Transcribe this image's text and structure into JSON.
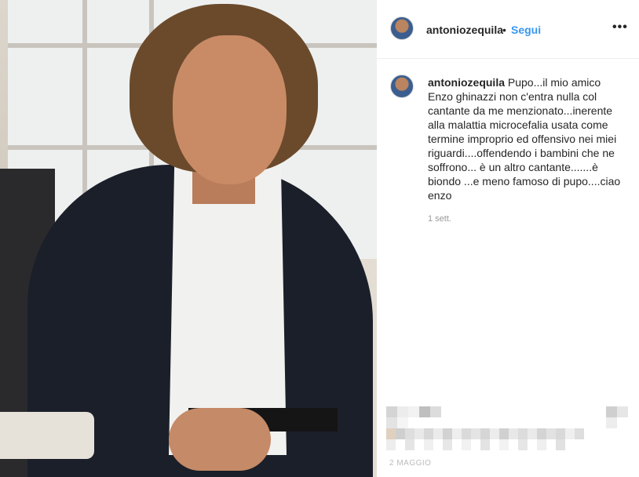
{
  "post": {
    "username": "antoniozequila",
    "separator": "•",
    "follow_label": "Segui",
    "more_icon": "•••",
    "caption_user": "antoniozequila",
    "caption_text": "Pupo...il mio amico Enzo ghinazzi non c'entra nulla col cantante da me menzionato...inerente alla malattia microcefalia usata come termine improprio ed offensivo nei miei riguardi....offendendo i bambini che ne soffrono... è un altro cantante.......è biondo ...e meno famoso di pupo....ciao enzo",
    "timestamp": "1 sett.",
    "footer_date": "2 MAGGIO"
  },
  "colors": {
    "link_blue": "#3897f0",
    "text_dark": "#262626",
    "muted_gray": "#999999"
  }
}
